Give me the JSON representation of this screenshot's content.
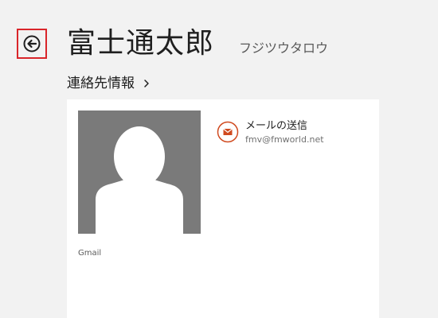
{
  "header": {
    "name": "富士通太郎",
    "reading": "フジツウタロウ"
  },
  "section": {
    "title": "連絡先情報"
  },
  "card": {
    "account_label": "Gmail",
    "email": {
      "action_label": "メールの送信",
      "address": "fmv@fmworld.net"
    }
  },
  "icons": {
    "back": "back-arrow-icon",
    "chevron": "chevron-right-icon",
    "email": "envelope-icon",
    "avatar": "person-silhouette"
  },
  "colors": {
    "background": "#f2f2f2",
    "card": "#ffffff",
    "highlight": "#d9252a",
    "email_accent": "#d04a1f",
    "avatar_bg": "#7a7a7a"
  }
}
